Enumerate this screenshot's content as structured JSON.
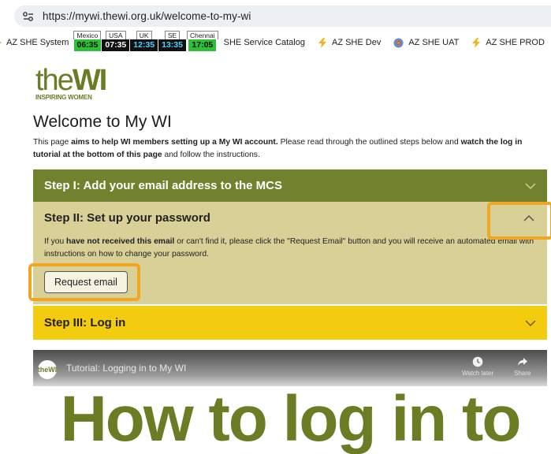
{
  "browser": {
    "url": "https://mywi.thewi.org.uk/welcome-to-my-wi"
  },
  "bookmarks": {
    "item_system": "AZ SHE System",
    "clocks": [
      {
        "city": "Mexico",
        "time": "06:35"
      },
      {
        "city": "USA",
        "time": "07:35"
      },
      {
        "city": "UK",
        "time": "12:35"
      },
      {
        "city": "SE",
        "time": "13:35"
      },
      {
        "city": "Chennai",
        "time": "17:05"
      }
    ],
    "item_catalog": "SHE Service Catalog",
    "item_dev": "AZ SHE Dev",
    "item_uat": "AZ SHE UAT",
    "item_prod": "AZ SHE PROD"
  },
  "logo": {
    "the": "the",
    "wi": "WI",
    "tagline": "INSPIRING WOMEN"
  },
  "page": {
    "title": "Welcome to My WI",
    "intro_1": "This page ",
    "intro_2": "aims to help WI members setting up a My WI account.",
    "intro_3": " Please read through the outlined steps below and ",
    "intro_4": "watch the log in tutorial at the bottom of this page",
    "intro_5": " and follow the instructions."
  },
  "steps": [
    {
      "title": "Step I: Add your email address to the MCS"
    },
    {
      "title": "Step II: Set up your password",
      "body_1": "If you ",
      "body_2": "have not received this email",
      "body_3": " or can't find it, please click the \"Request Email\" button and you will receive an automated email with instructions on how to change your password.",
      "button": "Request email"
    },
    {
      "title": "Step III: Log in"
    }
  ],
  "video": {
    "channel_logo": "theWI",
    "title": "Tutorial: Logging in to My WI",
    "watch_later": "Watch later",
    "share": "Share",
    "big_text": "How to log in to"
  },
  "colors": {
    "brand_green": "#71822e",
    "step2_bg": "#d8d097",
    "step3_yellow": "#f3cb0f",
    "highlight": "#f0a523"
  }
}
